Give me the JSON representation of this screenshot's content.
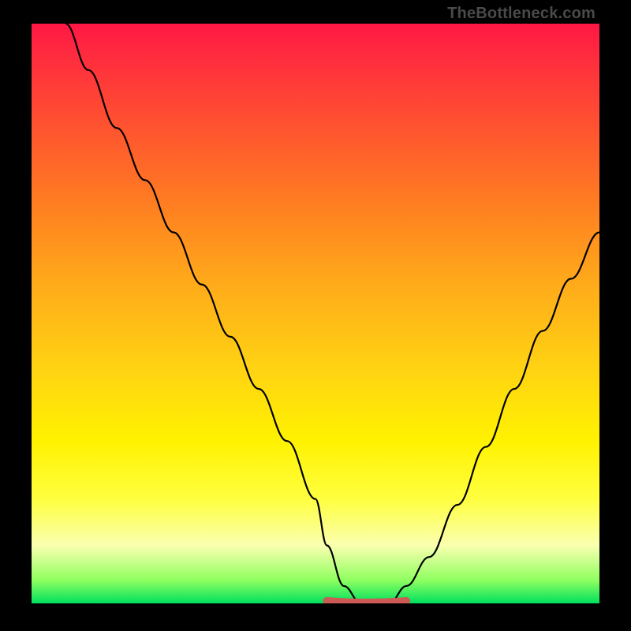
{
  "watermark": "TheBottleneck.com",
  "chart_data": {
    "type": "line",
    "title": "",
    "xlabel": "",
    "ylabel": "",
    "xlim": [
      0,
      100
    ],
    "ylim": [
      0,
      100
    ],
    "gradient_stops": [
      {
        "offset": 0.0,
        "color": "#ff1744"
      },
      {
        "offset": 0.05,
        "color": "#ff2a3f"
      },
      {
        "offset": 0.15,
        "color": "#ff4a33"
      },
      {
        "offset": 0.3,
        "color": "#ff7a22"
      },
      {
        "offset": 0.45,
        "color": "#ffab1a"
      },
      {
        "offset": 0.6,
        "color": "#ffd412"
      },
      {
        "offset": 0.72,
        "color": "#fff200"
      },
      {
        "offset": 0.82,
        "color": "#ffff40"
      },
      {
        "offset": 0.9,
        "color": "#faffb0"
      },
      {
        "offset": 0.96,
        "color": "#8fff60"
      },
      {
        "offset": 1.0,
        "color": "#00e05e"
      }
    ],
    "series": [
      {
        "name": "bottleneck-curve",
        "x": [
          6,
          10,
          15,
          20,
          25,
          30,
          35,
          40,
          45,
          50,
          52,
          55,
          58,
          60,
          63,
          66,
          70,
          75,
          80,
          85,
          90,
          95,
          100
        ],
        "y": [
          100,
          92,
          82,
          73,
          64,
          55,
          46,
          37,
          28,
          18,
          10,
          3,
          0,
          0,
          0,
          3,
          8,
          17,
          27,
          37,
          47,
          56,
          64
        ]
      }
    ],
    "flat_marker": {
      "x_start": 52,
      "x_end": 66,
      "y": 0,
      "color": "#cc5a55"
    }
  }
}
